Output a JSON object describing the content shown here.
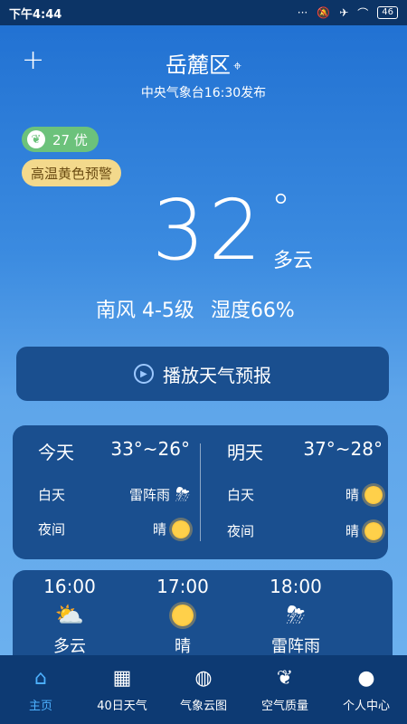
{
  "status": {
    "time": "下午4:44",
    "battery": "46"
  },
  "header": {
    "location": "岳麓区",
    "publish": "中央气象台16:30发布"
  },
  "badges": {
    "aqi": "27 优",
    "warning": "高温黄色预警"
  },
  "current": {
    "temp": "32",
    "degree": "°",
    "condition": "多云",
    "wind": "南风 4-5级",
    "humidity": "湿度66%"
  },
  "play": {
    "label": "播放天气预报"
  },
  "forecast": {
    "today": {
      "label": "今天",
      "range": "33°~26°",
      "day_label": "白天",
      "day_cond": "雷阵雨",
      "night_label": "夜间",
      "night_cond": "晴"
    },
    "tomorrow": {
      "label": "明天",
      "range": "37°~28°",
      "day_label": "白天",
      "day_cond": "晴",
      "night_label": "夜间",
      "night_cond": "晴"
    }
  },
  "hourly": [
    {
      "time": "16:00",
      "cond": "多云"
    },
    {
      "time": "17:00",
      "cond": "晴"
    },
    {
      "time": "18:00",
      "cond": "雷阵雨"
    }
  ],
  "nav": [
    {
      "label": "主页"
    },
    {
      "label": "40日天气"
    },
    {
      "label": "气象云图"
    },
    {
      "label": "空气质量"
    },
    {
      "label": "个人中心"
    }
  ],
  "colors": {
    "accent": "#4db1ff",
    "card": "#1a4f8f",
    "aqi_green": "#6cc27b",
    "warning_yellow": "#f3d98c"
  }
}
